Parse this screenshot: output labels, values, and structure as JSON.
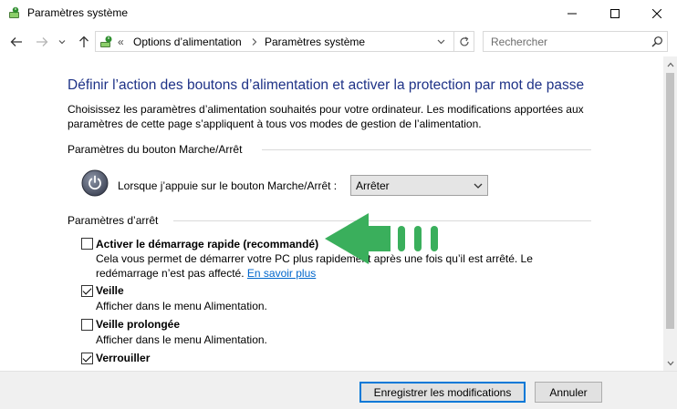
{
  "window": {
    "title": "Paramètres système",
    "icon": "power-options-app-icon"
  },
  "nav": {
    "breadcrumb_prefix": "«",
    "breadcrumb": [
      "Options d’alimentation",
      "Paramètres système"
    ],
    "search_placeholder": "Rechercher"
  },
  "page": {
    "title": "Définir l’action des boutons d’alimentation et activer la protection par mot de passe",
    "intro": "Choisissez les paramètres d’alimentation souhaités pour votre ordinateur. Les modifications apportées aux paramètres de cette page s’appliquent à tous vos modes de gestion de l’alimentation.",
    "power_section": {
      "label": "Paramètres du bouton Marche/Arrêt",
      "row_label": "Lorsque j’appuie sur le bouton Marche/Arrêt :",
      "selected": "Arrêter"
    },
    "shutdown_section": {
      "label": "Paramètres d’arrêt",
      "options": [
        {
          "label": "Activer le démarrage rapide (recommandé)",
          "checked": false,
          "desc": "Cela vous permet de démarrer votre PC plus rapidement après une fois qu’il est arrêté. Le redémarrage n’est pas affecté.",
          "link": "En savoir plus"
        },
        {
          "label": "Veille",
          "checked": true,
          "desc": "Afficher dans le menu Alimentation."
        },
        {
          "label": "Veille prolongée",
          "checked": false,
          "desc": "Afficher dans le menu Alimentation."
        },
        {
          "label": "Verrouiller",
          "checked": true
        }
      ]
    }
  },
  "footer": {
    "save_label": "Enregistrer les modifications",
    "cancel_label": "Annuler"
  },
  "colors": {
    "title_blue": "#1e3287",
    "link_blue": "#0066cc",
    "arrow_green": "#3aaf5c"
  }
}
